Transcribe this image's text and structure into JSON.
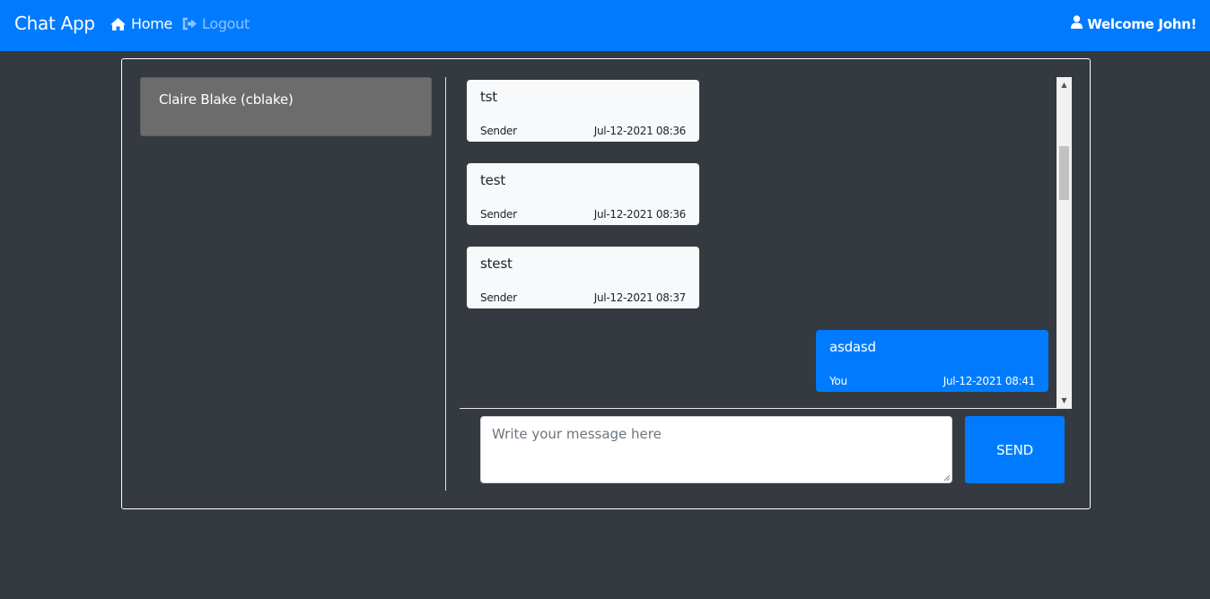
{
  "app": {
    "brand": "Chat App",
    "nav": {
      "home_label": "Home",
      "home_icon": "home-icon",
      "logout_label": "Logout",
      "logout_icon": "sign-out-icon"
    },
    "welcome_text": "Welcome John!",
    "welcome_icon": "user-icon"
  },
  "colors": {
    "primary": "#007bff",
    "background": "#343a40",
    "contact_active": "#6c6c6c",
    "incoming_bubble": "#f8f9fa"
  },
  "contacts": [
    {
      "label": "Claire Blake (cblake)"
    }
  ],
  "messages": [
    {
      "text": "tst",
      "sender": "Sender",
      "time": "Jul-12-2021 08:36",
      "direction": "incoming"
    },
    {
      "text": "test",
      "sender": "Sender",
      "time": "Jul-12-2021 08:36",
      "direction": "incoming"
    },
    {
      "text": "stest",
      "sender": "Sender",
      "time": "Jul-12-2021 08:37",
      "direction": "incoming"
    },
    {
      "text": "asdasd",
      "sender": "You",
      "time": "Jul-12-2021 08:41",
      "direction": "outgoing"
    }
  ],
  "composer": {
    "placeholder": "Write your message here",
    "value": "",
    "send_label": "SEND"
  }
}
